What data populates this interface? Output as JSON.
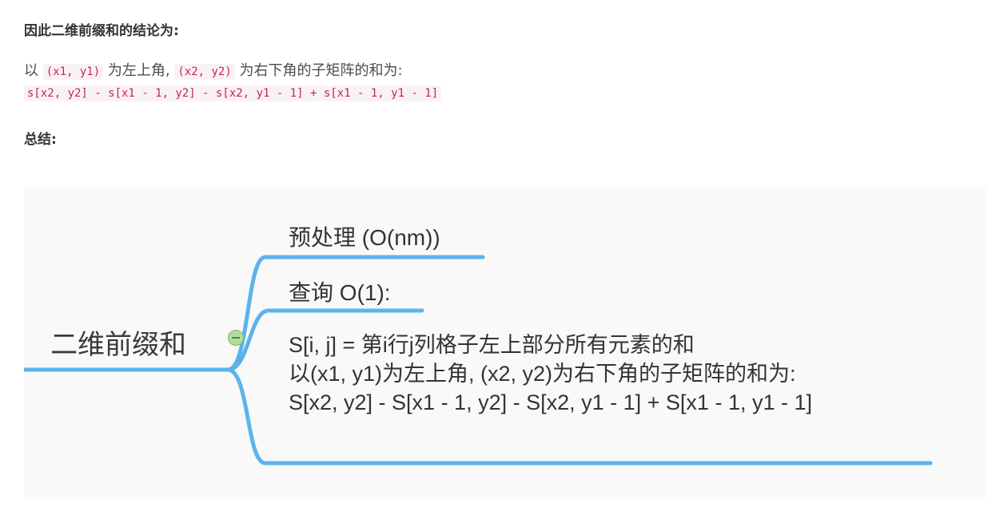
{
  "heading1": "因此二维前缀和的结论为:",
  "para": {
    "prefix": "以 ",
    "code1": "(x1, y1)",
    "mid": " 为左上角, ",
    "code2": "(x2, y2)",
    "suffix": " 为右下角的子矩阵的和为:"
  },
  "formula_code": "s[x2, y2] - s[x1 - 1, y2] - s[x2, y1 - 1] + s[x1 - 1, y1 - 1]",
  "heading2": "总结:",
  "mindmap": {
    "root": "二维前缀和",
    "branch_preprocess": "预处理 (O(nm))",
    "branch_query": "查询 O(1):",
    "branch_detail_lines": [
      "S[i, j] = 第i行j列格子左上部分所有元素的和",
      "以(x1, y1)为左上角, (x2, y2)为右下角的子矩阵的和为:",
      "S[x2, y2] - S[x1 - 1, y2] - S[x2, y1 - 1] + S[x1 - 1, y1 - 1]"
    ],
    "line_color": "#5cb3ea",
    "collapse_icon": "minus-circle-icon"
  }
}
